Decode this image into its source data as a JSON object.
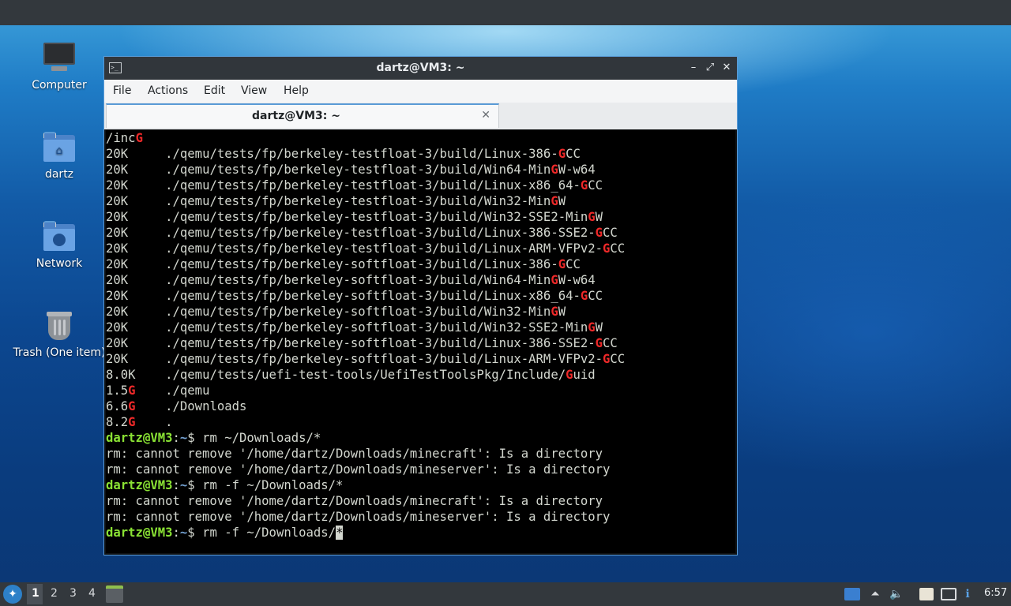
{
  "desktop": {
    "icons": [
      {
        "label": "Computer"
      },
      {
        "label": "dartz"
      },
      {
        "label": "Network"
      },
      {
        "label": "Trash (One item)"
      }
    ]
  },
  "window": {
    "title": "dartz@VM3: ~",
    "buttons": {
      "minimize": "–",
      "maximize": "⤢",
      "close": "✕"
    },
    "menu": [
      "File",
      "Actions",
      "Edit",
      "View",
      "Help"
    ],
    "tab": {
      "label": "dartz@VM3: ~",
      "close": "✕"
    }
  },
  "terminal": {
    "lines": [
      {
        "kind": "du",
        "size": "",
        "path": "/inc",
        "hl": "G",
        "rest": ""
      },
      {
        "kind": "du",
        "size": "20K",
        "path": "./qemu/tests/fp/berkeley-testfloat-3/build/Linux-386-",
        "hl": "G",
        "rest": "CC"
      },
      {
        "kind": "du",
        "size": "20K",
        "path": "./qemu/tests/fp/berkeley-testfloat-3/build/Win64-Min",
        "hl": "G",
        "rest": "W-w64"
      },
      {
        "kind": "du",
        "size": "20K",
        "path": "./qemu/tests/fp/berkeley-testfloat-3/build/Linux-x86_64-",
        "hl": "G",
        "rest": "CC"
      },
      {
        "kind": "du",
        "size": "20K",
        "path": "./qemu/tests/fp/berkeley-testfloat-3/build/Win32-Min",
        "hl": "G",
        "rest": "W"
      },
      {
        "kind": "du",
        "size": "20K",
        "path": "./qemu/tests/fp/berkeley-testfloat-3/build/Win32-SSE2-Min",
        "hl": "G",
        "rest": "W"
      },
      {
        "kind": "du",
        "size": "20K",
        "path": "./qemu/tests/fp/berkeley-testfloat-3/build/Linux-386-SSE2-",
        "hl": "G",
        "rest": "CC"
      },
      {
        "kind": "du",
        "size": "20K",
        "path": "./qemu/tests/fp/berkeley-testfloat-3/build/Linux-ARM-VFPv2-",
        "hl": "G",
        "rest": "CC"
      },
      {
        "kind": "du",
        "size": "20K",
        "path": "./qemu/tests/fp/berkeley-softfloat-3/build/Linux-386-",
        "hl": "G",
        "rest": "CC"
      },
      {
        "kind": "du",
        "size": "20K",
        "path": "./qemu/tests/fp/berkeley-softfloat-3/build/Win64-Min",
        "hl": "G",
        "rest": "W-w64"
      },
      {
        "kind": "du",
        "size": "20K",
        "path": "./qemu/tests/fp/berkeley-softfloat-3/build/Linux-x86_64-",
        "hl": "G",
        "rest": "CC"
      },
      {
        "kind": "du",
        "size": "20K",
        "path": "./qemu/tests/fp/berkeley-softfloat-3/build/Win32-Min",
        "hl": "G",
        "rest": "W"
      },
      {
        "kind": "du",
        "size": "20K",
        "path": "./qemu/tests/fp/berkeley-softfloat-3/build/Win32-SSE2-Min",
        "hl": "G",
        "rest": "W"
      },
      {
        "kind": "du",
        "size": "20K",
        "path": "./qemu/tests/fp/berkeley-softfloat-3/build/Linux-386-SSE2-",
        "hl": "G",
        "rest": "CC"
      },
      {
        "kind": "du",
        "size": "20K",
        "path": "./qemu/tests/fp/berkeley-softfloat-3/build/Linux-ARM-VFPv2-",
        "hl": "G",
        "rest": "CC"
      },
      {
        "kind": "du",
        "size": "8.0K",
        "path": "./qemu/tests/uefi-test-tools/UefiTestToolsPkg/Include/",
        "hl": "G",
        "rest": "uid"
      },
      {
        "kind": "dus",
        "size": "1.5",
        "sizehl": "G",
        "path": "./qemu"
      },
      {
        "kind": "dus",
        "size": "6.6",
        "sizehl": "G",
        "path": "./Downloads"
      },
      {
        "kind": "dus",
        "size": "8.2",
        "sizehl": "G",
        "path": "."
      },
      {
        "kind": "cmd",
        "user": "dartz@VM3",
        "colon": ":",
        "dir": "~",
        "sym": "$ ",
        "cmd": "rm ~/Downloads/*"
      },
      {
        "kind": "out",
        "text": "rm: cannot remove '/home/dartz/Downloads/minecraft': Is a directory"
      },
      {
        "kind": "out",
        "text": "rm: cannot remove '/home/dartz/Downloads/mineserver': Is a directory"
      },
      {
        "kind": "cmd",
        "user": "dartz@VM3",
        "colon": ":",
        "dir": "~",
        "sym": "$ ",
        "cmd": "rm -f ~/Downloads/*"
      },
      {
        "kind": "out",
        "text": "rm: cannot remove '/home/dartz/Downloads/minecraft': Is a directory"
      },
      {
        "kind": "out",
        "text": "rm: cannot remove '/home/dartz/Downloads/mineserver': Is a directory"
      },
      {
        "kind": "cur",
        "user": "dartz@VM3",
        "colon": ":",
        "dir": "~",
        "sym": "$ ",
        "cmd": "rm -f ~/Downloads/",
        "cursor": "*"
      }
    ]
  },
  "taskbar": {
    "workspaces": [
      "1",
      "2",
      "3",
      "4"
    ],
    "active_workspace": "1",
    "clock": "6:57"
  },
  "colors": {
    "accent": "#5a9bd6",
    "terminal_bg": "#000000",
    "terminal_fg": "#d3d7cf",
    "highlight_red": "#ef2929",
    "prompt_green": "#8ae234",
    "prompt_dir_blue": "#729fcf",
    "panel_bg": "#33383d"
  },
  "icons": [
    "computer-icon",
    "home-folder-icon",
    "network-folder-icon",
    "trash-icon",
    "terminal-app-icon",
    "start-menu-icon",
    "terminal-task-icon",
    "show-desktop-icon",
    "upload-icon",
    "volume-icon",
    "clipboard-icon",
    "network-status-icon",
    "notification-icon"
  ]
}
